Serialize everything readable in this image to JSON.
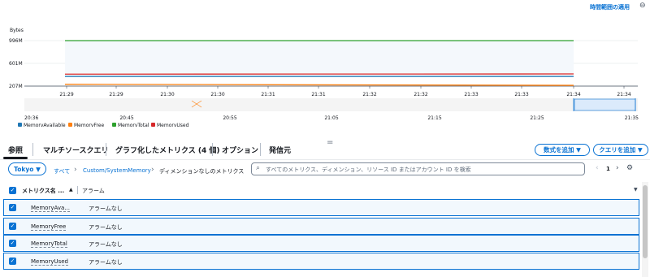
{
  "header": {
    "apply_range_label": "時間範囲の適用",
    "zoom_out_icon": "zoom-out-icon"
  },
  "chart_data": {
    "type": "line",
    "ylabel": "Bytes",
    "ytick_labels": [
      "996M",
      "601M",
      "207M"
    ],
    "yticks": [
      996,
      601,
      207
    ],
    "ylim": [
      207,
      1000
    ],
    "xtick_labels": [
      "21:29",
      "21:29",
      "21:30",
      "21:30",
      "21:31",
      "21:31",
      "21:32",
      "21:32",
      "21:33",
      "21:33",
      "21:34",
      "21:34"
    ],
    "series": [
      {
        "name": "MemoryAvailable",
        "color": "#1f77b4",
        "values": [
          375,
          375
        ]
      },
      {
        "name": "MemoryFree",
        "color": "#ff7f0e",
        "values": [
          238,
          220
        ]
      },
      {
        "name": "MemoryTotal",
        "color": "#2ca02c",
        "values": [
          996,
          996
        ]
      },
      {
        "name": "MemoryUsed",
        "color": "#d62728",
        "values": [
          415,
          418
        ]
      }
    ],
    "overview": {
      "xtick_labels": [
        "20:36",
        "20:45",
        "20:55",
        "21:05",
        "21:15",
        "21:25",
        "21:35"
      ]
    }
  },
  "tabs": [
    {
      "label": "参照"
    },
    {
      "label": "マルチソースクエリ"
    },
    {
      "label": "グラフ化したメトリクス (4 個)"
    },
    {
      "label": "オプション"
    },
    {
      "label": "発信元"
    }
  ],
  "tab_extra_glyph": "=",
  "actions": {
    "add_formula": "数式を追加 ▼",
    "add_query": "クエリを追加 ▼"
  },
  "browse": {
    "region": "Tokyo ▼",
    "crumb_all": "すべて",
    "crumb_namespace": "Custom/SystemMemory",
    "crumb_current": "ディメンションなしのメトリクス",
    "search_placeholder": "すべてのメトリクス、ディメンション、リソース ID またはアカウント ID を検索",
    "page_prev": "‹",
    "page_num": "1",
    "page_next": "›",
    "settings_icon": "settings-icon"
  },
  "table": {
    "col_name": "メトリクス名 ...",
    "sort_glyph": "▲",
    "col_alarm": "アラーム",
    "filter_glyph": "▼",
    "rows": [
      {
        "name": "MemoryAva...",
        "alarm": "アラームなし"
      },
      {
        "name": "MemoryFree",
        "alarm": "アラームなし"
      },
      {
        "name": "MemoryTotal",
        "alarm": "アラームなし"
      },
      {
        "name": "MemoryUsed",
        "alarm": "アラームなし"
      }
    ]
  }
}
